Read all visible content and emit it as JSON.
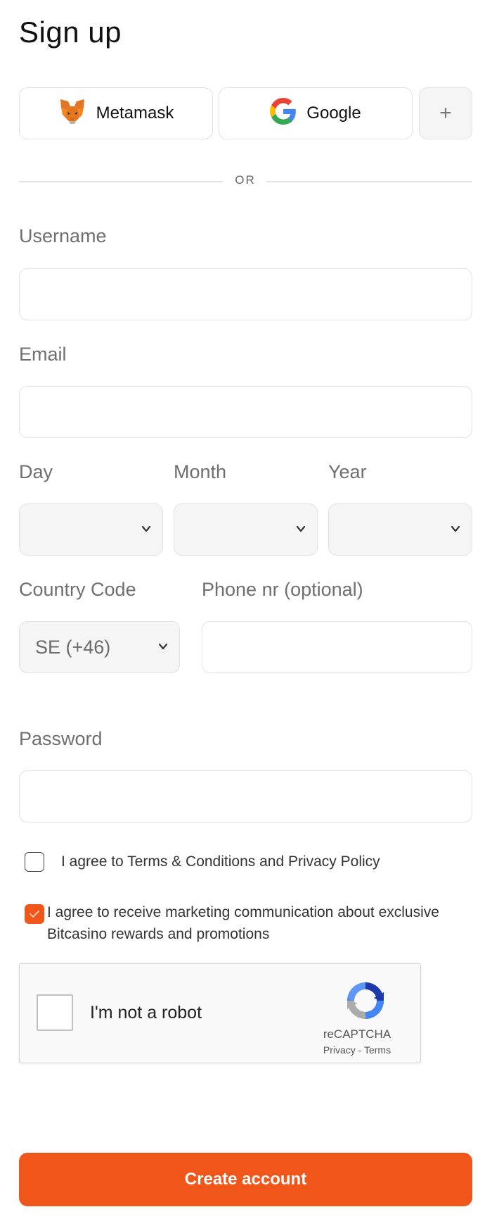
{
  "header": {
    "title": "Sign up"
  },
  "social": {
    "metamask_label": "Metamask",
    "google_label": "Google",
    "more_label": "+"
  },
  "divider": {
    "text": "OR"
  },
  "fields": {
    "username_label": "Username",
    "username_value": "",
    "email_label": "Email",
    "email_value": "",
    "day_label": "Day",
    "day_value": "",
    "month_label": "Month",
    "month_value": "",
    "year_label": "Year",
    "year_value": "",
    "country_code_label": "Country Code",
    "country_code_value": "SE (+46)",
    "phone_label": "Phone nr (optional)",
    "phone_value": "",
    "password_label": "Password",
    "password_value": ""
  },
  "agreements": {
    "terms_text": "I agree to Terms & Conditions and Privacy Policy",
    "terms_checked": false,
    "marketing_text": "I agree to receive marketing communication about exclusive Bitcasino rewards and promotions",
    "marketing_checked": true
  },
  "recaptcha": {
    "label": "I'm not a robot",
    "brand": "reCAPTCHA",
    "links": "Privacy - Terms"
  },
  "submit": {
    "label": "Create account"
  },
  "colors": {
    "accent": "#f0551a",
    "border": "#e2e2e2",
    "select_bg": "#f6f5f5"
  }
}
